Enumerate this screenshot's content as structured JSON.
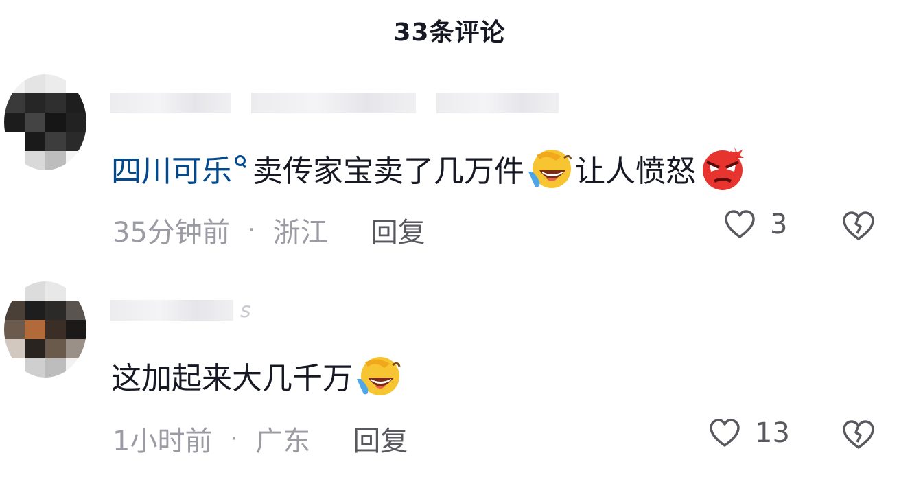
{
  "header": {
    "title": "33条评论"
  },
  "comments": [
    {
      "mention": "四川可乐",
      "text": "卖传家宝卖了几万件",
      "text_after_emoji": "让人愤怒",
      "emojis": [
        "laugh-cry-emoji",
        "angry-face-emoji"
      ],
      "time": "35分钟前",
      "separator": "·",
      "location": "浙江",
      "reply_label": "回复",
      "likes": "3"
    },
    {
      "text": "这加起来大几千万",
      "emojis": [
        "laugh-cry-emoji"
      ],
      "time": "1小时前",
      "separator": "·",
      "location": "广东",
      "reply_label": "回复",
      "likes": "13"
    }
  ],
  "colors": {
    "mention": "#04498d",
    "text": "#161823",
    "meta": "#9b9ba3",
    "action": "#58585f"
  }
}
